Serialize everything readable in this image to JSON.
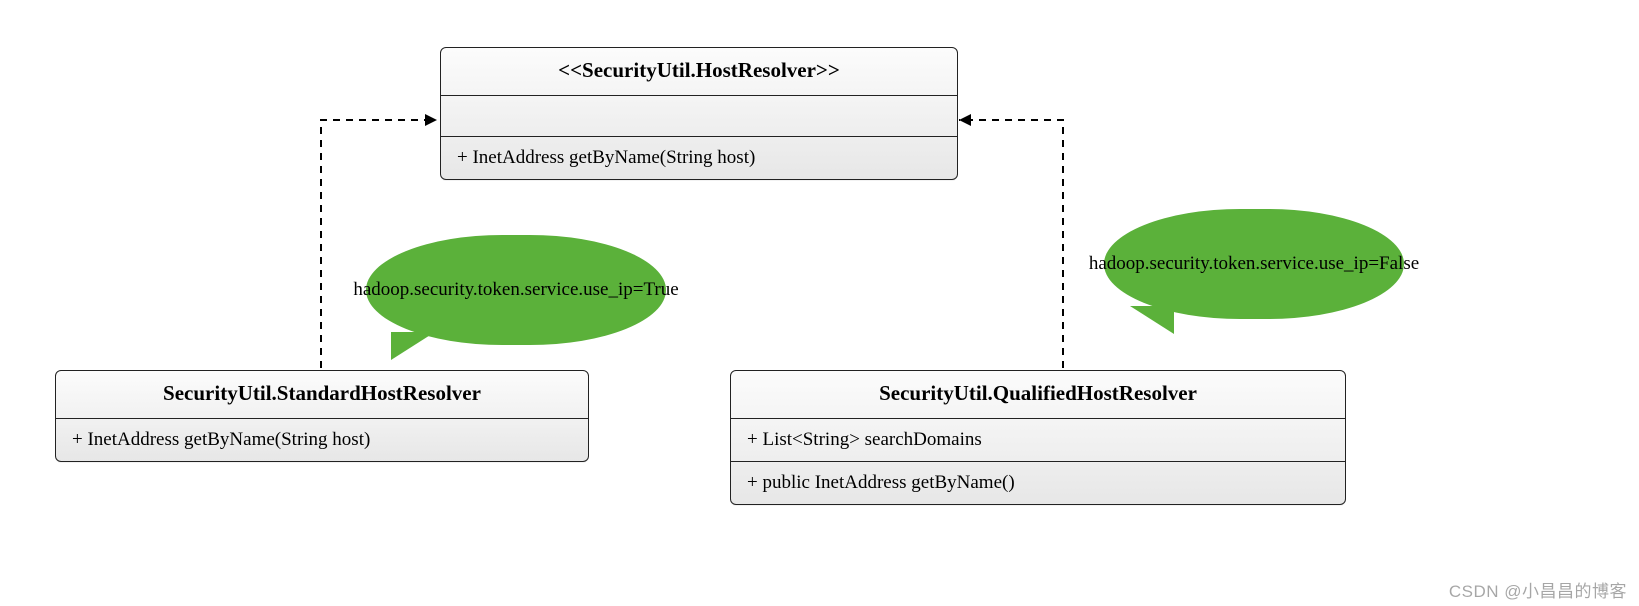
{
  "interface": {
    "title": "<<SecurityUtil.HostResolver>>",
    "method": "+ InetAddress getByName(String host)"
  },
  "standard": {
    "title": "SecurityUtil.StandardHostResolver",
    "method": "+ InetAddress getByName(String host)"
  },
  "qualified": {
    "title": "SecurityUtil.QualifiedHostResolver",
    "field": "+ List<String> searchDomains",
    "method": "+ public InetAddress getByName()"
  },
  "note_left": "hadoop.security.token.service.use_ip=True",
  "note_right": "hadoop.security.token.service.use_ip=False",
  "watermark": "CSDN @小昌昌的博客"
}
